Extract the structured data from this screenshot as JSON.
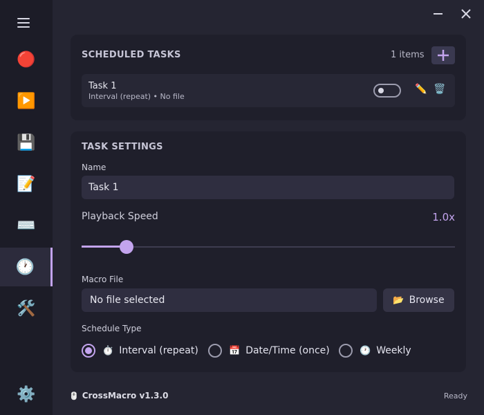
{
  "window": {
    "minimize_icon": "minimize-icon",
    "close_icon": "close-icon"
  },
  "sidebar": {
    "menu_icon": "hamburger-menu-icon",
    "items": [
      {
        "name": "record",
        "glyph": "🔴"
      },
      {
        "name": "play",
        "glyph": "▶️"
      },
      {
        "name": "save",
        "glyph": "💾"
      },
      {
        "name": "editor",
        "glyph": "📝"
      },
      {
        "name": "keyboard",
        "glyph": "⌨️"
      },
      {
        "name": "scheduler",
        "glyph": "🕐",
        "active": true
      },
      {
        "name": "tools",
        "glyph": "🛠️"
      }
    ],
    "settings_glyph": "⚙️"
  },
  "scheduled": {
    "title": "SCHEDULED TASKS",
    "count": "1 items",
    "add_glyph": "+",
    "tasks": [
      {
        "name": "Task 1",
        "detail": "Interval (repeat) • No file",
        "enabled": false
      }
    ],
    "edit_glyph": "✏️",
    "delete_glyph": "🗑️"
  },
  "settings": {
    "title": "TASK SETTINGS",
    "name_label": "Name",
    "name_value": "Task 1",
    "speed_label": "Playback Speed",
    "speed_value": "1.0x",
    "speed_fraction": 0.1,
    "macro_label": "Macro File",
    "macro_value": "No file selected",
    "browse_glyph": "📂",
    "browse_label": "Browse",
    "schedule_label": "Schedule Type",
    "schedule_options": [
      {
        "glyph": "⏱️",
        "label": "Interval (repeat)",
        "checked": true
      },
      {
        "glyph": "📅",
        "label": "Date/Time (once)",
        "checked": false
      },
      {
        "glyph": "🕐",
        "label": "Weekly",
        "checked": false
      }
    ]
  },
  "footer": {
    "mouse_glyph": "🖱️",
    "app_name": "CrossMacro v1.3.0",
    "status": "Ready"
  },
  "colors": {
    "accent": "#c3a4ee",
    "card": "#1f1f2b",
    "background": "#252532",
    "sidebar": "#1c1c27"
  }
}
